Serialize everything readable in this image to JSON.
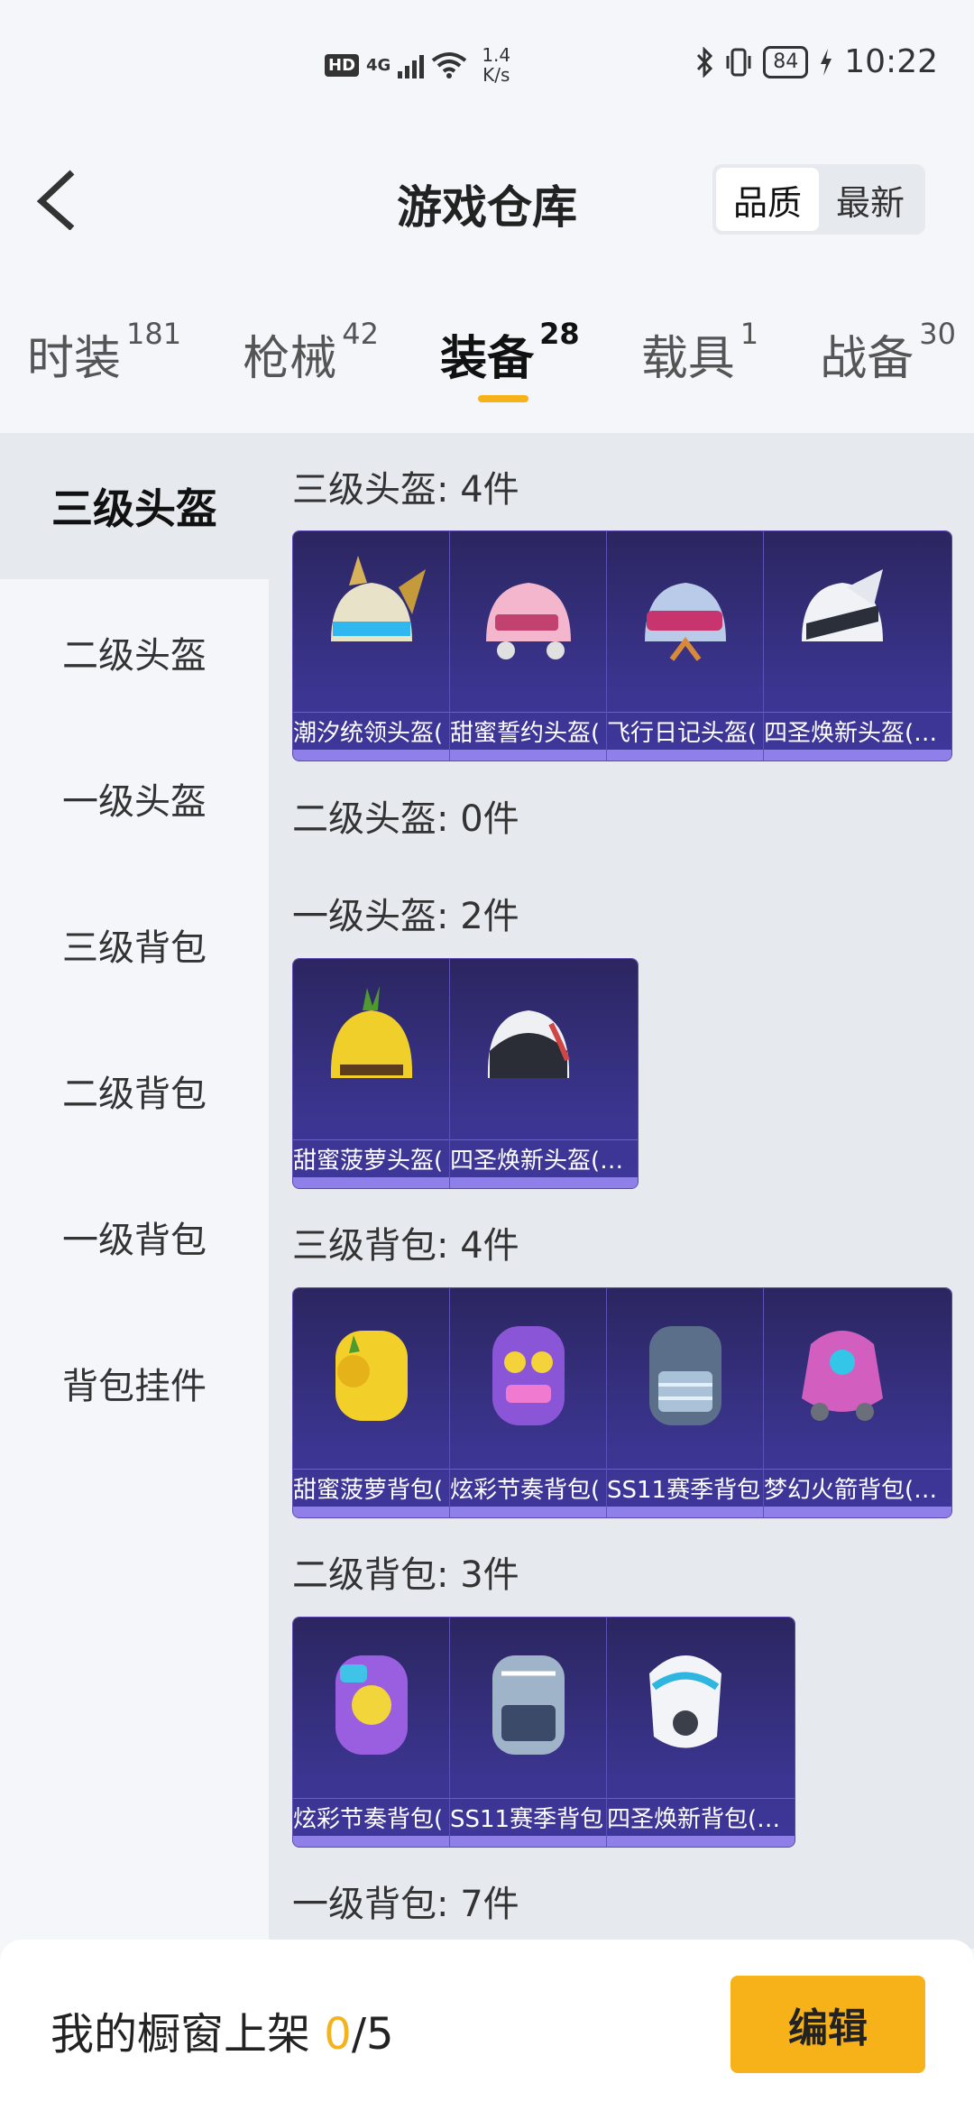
{
  "status": {
    "network": "4G",
    "hd": "HD",
    "speed_value": "1.4",
    "speed_unit": "K/s",
    "battery": "84",
    "time": "10:22"
  },
  "header": {
    "title": "游戏仓库",
    "sort_options": [
      "品质",
      "最新"
    ],
    "sort_active": "品质"
  },
  "tabs": [
    {
      "label": "时装",
      "count": "181"
    },
    {
      "label": "枪械",
      "count": "42"
    },
    {
      "label": "装备",
      "count": "28"
    },
    {
      "label": "载具",
      "count": "1"
    },
    {
      "label": "战备",
      "count": "30"
    }
  ],
  "sidebar": {
    "items": [
      "三级头盔",
      "二级头盔",
      "一级头盔",
      "三级背包",
      "二级背包",
      "一级背包",
      "背包挂件"
    ],
    "active": "三级头盔"
  },
  "sections": [
    {
      "title": "三级头盔: 4件",
      "items": [
        "潮汐统领头盔(",
        "甜蜜誓约头盔(",
        "飞行日记头盔(",
        "四圣焕新头盔(…"
      ]
    },
    {
      "title": "二级头盔: 0件",
      "items": []
    },
    {
      "title": "一级头盔: 2件",
      "items": [
        "甜蜜菠萝头盔(",
        "四圣焕新头盔(…"
      ]
    },
    {
      "title": "三级背包: 4件",
      "items": [
        "甜蜜菠萝背包(",
        "炫彩节奏背包(",
        "SS11赛季背包",
        "梦幻火箭背包(…"
      ]
    },
    {
      "title": "二级背包: 3件",
      "items": [
        "炫彩节奏背包(",
        "SS11赛季背包",
        "四圣焕新背包(…"
      ]
    },
    {
      "title": "一级背包: 7件",
      "items": []
    }
  ],
  "bottom": {
    "shelf_prefix": "我的橱窗上架 ",
    "shelf_count": "0",
    "shelf_total": "/5",
    "edit_label": "编辑"
  },
  "colors": {
    "accent": "#f5b21b",
    "card_bg": "#3c3591"
  }
}
